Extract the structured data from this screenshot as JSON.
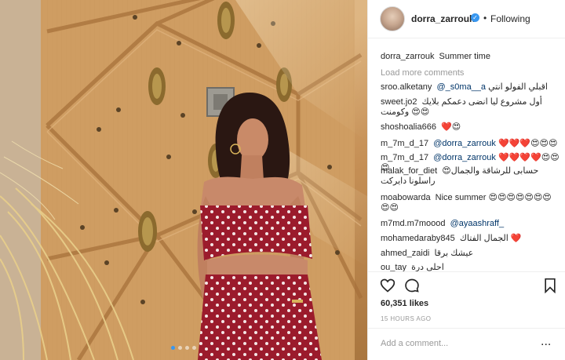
{
  "post": {
    "username": "dorra_zarrouk",
    "verified": true,
    "separator": "•",
    "follow_state": "Following",
    "caption_user": "dorra_zarrouk",
    "caption_text": "Summer time",
    "load_more": "Load more comments",
    "likes": "60,351 likes",
    "time": "15 HOURS AGO",
    "add_comment_placeholder": "Add a comment...",
    "more_icon": "..."
  },
  "comments": [
    {
      "user": "sroo.alketany",
      "mention": "@_s0ma__a",
      "text": "اقبلي الفولو انتي"
    },
    {
      "user": "sweet.jo2",
      "mention": "",
      "text": "أول مشروع ليا انضى دعمكم بلايك وكومنت 😍😍"
    },
    {
      "user": "shoshoalia666",
      "mention": "",
      "text": "❤️😍"
    },
    {
      "user": "m_7m_d_17",
      "mention": "@dorra_zarrouk",
      "text": "❤️❤️❤️😍😍😍"
    },
    {
      "user": "m_7m_d_17",
      "mention": "@dorra_zarrouk",
      "text": "❤️❤️❤️❤️😍😍😍"
    },
    {
      "user": "malak_for_diet",
      "mention": "",
      "text": "😍حسابى للرشاقة والجمال راسلونا دايركت"
    },
    {
      "user": "moabowarda",
      "mention": "",
      "text": "Nice summer 😍😍😍😍😍😍😍😍😍"
    },
    {
      "user": "m7md.m7moood",
      "mention": "@ayaashraff_",
      "text": ""
    },
    {
      "user": "mohamedaraby845",
      "mention": "",
      "text": "الجمال الفتاك ❤️"
    },
    {
      "user": "ahmed_zaidi",
      "mention": "",
      "text": "عيشك برقا"
    },
    {
      "user": "ou_tay",
      "mention": "",
      "text": "احلى درة"
    }
  ],
  "icons": {
    "heart": "heart-icon",
    "comment": "comment-bubble-icon",
    "bookmark": "bookmark-icon",
    "verified": "verified-badge-icon"
  },
  "colors": {
    "link": "#003569",
    "muted": "#999999",
    "verified": "#3897f0",
    "border": "#efefef"
  }
}
